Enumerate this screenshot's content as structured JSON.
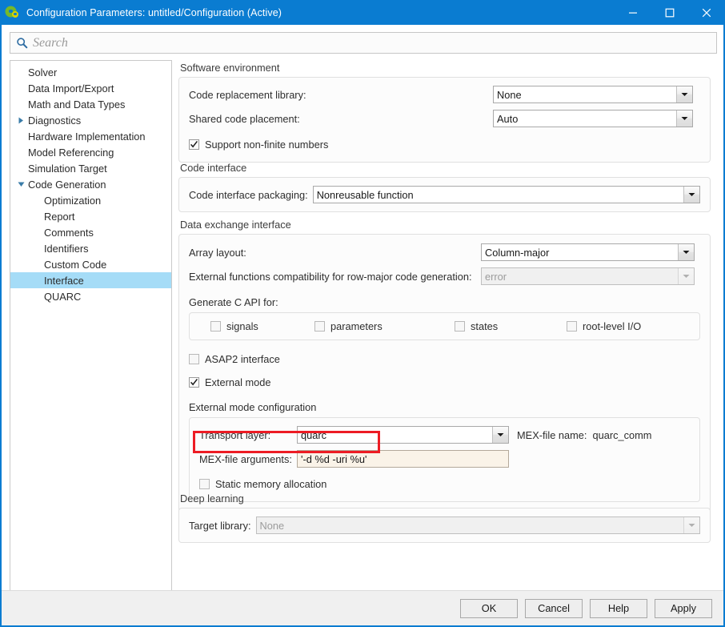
{
  "window": {
    "title": "Configuration Parameters: untitled/Configuration (Active)",
    "icon": "simulink-config-icon",
    "minimize_label": "–",
    "maximize_label": "□",
    "close_label": "✕",
    "accent_color": "#0a7cd1"
  },
  "search": {
    "placeholder": "Search",
    "value": "",
    "icon": "search-icon"
  },
  "tree": {
    "selected": "Interface",
    "items": [
      {
        "label": "Solver",
        "level": 0,
        "twisty": "none",
        "selected": false
      },
      {
        "label": "Data Import/Export",
        "level": 0,
        "twisty": "none",
        "selected": false
      },
      {
        "label": "Math and Data Types",
        "level": 0,
        "twisty": "none",
        "selected": false
      },
      {
        "label": "Diagnostics",
        "level": 0,
        "twisty": "collapsed",
        "selected": false
      },
      {
        "label": "Hardware Implementation",
        "level": 0,
        "twisty": "none",
        "selected": false
      },
      {
        "label": "Model Referencing",
        "level": 0,
        "twisty": "none",
        "selected": false
      },
      {
        "label": "Simulation Target",
        "level": 0,
        "twisty": "none",
        "selected": false
      },
      {
        "label": "Code Generation",
        "level": 0,
        "twisty": "expanded",
        "selected": false
      },
      {
        "label": "Optimization",
        "level": 1,
        "twisty": "none",
        "selected": false
      },
      {
        "label": "Report",
        "level": 1,
        "twisty": "none",
        "selected": false
      },
      {
        "label": "Comments",
        "level": 1,
        "twisty": "none",
        "selected": false
      },
      {
        "label": "Identifiers",
        "level": 1,
        "twisty": "none",
        "selected": false
      },
      {
        "label": "Custom Code",
        "level": 1,
        "twisty": "none",
        "selected": false
      },
      {
        "label": "Interface",
        "level": 1,
        "twisty": "none",
        "selected": true
      },
      {
        "label": "QUARC",
        "level": 1,
        "twisty": "none",
        "selected": false
      }
    ]
  },
  "sections": {
    "software_environment": {
      "title": "Software environment",
      "code_replacement_library": {
        "label": "Code replacement library:",
        "value": "None",
        "enabled": true
      },
      "shared_code_placement": {
        "label": "Shared code placement:",
        "value": "Auto",
        "enabled": true
      },
      "support_non_finite": {
        "label": "Support non-finite numbers",
        "checked": true
      }
    },
    "code_interface": {
      "title": "Code interface",
      "code_interface_packaging": {
        "label": "Code interface packaging:",
        "value": "Nonreusable function",
        "enabled": true
      }
    },
    "data_exchange_interface": {
      "title": "Data exchange interface",
      "array_layout": {
        "label": "Array layout:",
        "value": "Column-major",
        "enabled": true
      },
      "external_functions_compat": {
        "label": "External functions compatibility for row-major code generation:",
        "value": "error",
        "enabled": false
      },
      "generate_c_api_label": "Generate C API for:",
      "c_api_options": [
        {
          "label": "signals",
          "checked": false
        },
        {
          "label": "parameters",
          "checked": false
        },
        {
          "label": "states",
          "checked": false
        },
        {
          "label": "root-level I/O",
          "checked": false
        }
      ],
      "asap2_interface": {
        "label": "ASAP2 interface",
        "checked": false
      },
      "external_mode": {
        "label": "External mode",
        "checked": true
      },
      "external_mode_config": {
        "title": "External mode configuration",
        "transport_layer": {
          "label": "Transport layer:",
          "value": "quarc",
          "enabled": true
        },
        "mex_file_name": {
          "label": "MEX-file name:",
          "value": "quarc_comm"
        },
        "mex_file_arguments": {
          "label": "MEX-file arguments:",
          "value": "'-d %d -uri %u'"
        },
        "static_memory_allocation": {
          "label": "Static memory allocation",
          "checked": false
        }
      }
    },
    "deep_learning": {
      "title": "Deep learning",
      "target_library": {
        "label": "Target library:",
        "value": "None",
        "enabled": false
      }
    },
    "overflow_indicator": "..."
  },
  "annotation": {
    "color": "#ed1c24",
    "target": "mex-file-arguments-row"
  },
  "footer": {
    "buttons": [
      {
        "label": "OK",
        "name": "ok-button"
      },
      {
        "label": "Cancel",
        "name": "cancel-button"
      },
      {
        "label": "Help",
        "name": "help-button"
      },
      {
        "label": "Apply",
        "name": "apply-button"
      }
    ]
  }
}
